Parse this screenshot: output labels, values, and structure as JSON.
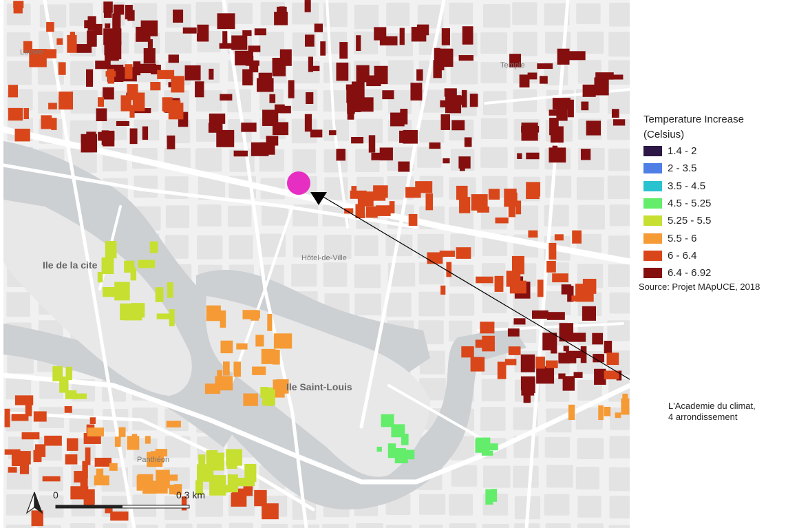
{
  "map": {
    "labels": {
      "louvre": "Louvre",
      "temple": "Temple",
      "ile_de_la_cite": "Ile de la cite",
      "hotel_de_ville": "Hôtel-de-Ville",
      "ile_saint_louis": "Ile Saint-Louis",
      "pantheon": "Panthéon"
    },
    "colors": {
      "background": "#f1f1f1",
      "blocks": "#e3e3e3",
      "roads": "#ffffff",
      "water": "#ccd0d3",
      "marker": "#e62fc2"
    }
  },
  "legend": {
    "title": "Temperature Increase (Celsius)",
    "classes": [
      {
        "label": "1.4 - 2",
        "color": "#2d1746"
      },
      {
        "label": "2 - 3.5",
        "color": "#4f7ee6"
      },
      {
        "label": "3.5 - 4.5",
        "color": "#29c3cf"
      },
      {
        "label": "4.5 - 5.25",
        "color": "#63ed6b"
      },
      {
        "label": "5.25 - 5.5",
        "color": "#c7df31"
      },
      {
        "label": "5.5 - 6",
        "color": "#f59a35"
      },
      {
        "label": "6 - 6.4",
        "color": "#d9461a"
      },
      {
        "label": "6.4 - 6.92",
        "color": "#850f0f"
      }
    ],
    "source": "Source: Projet MApUCE, 2018"
  },
  "callout": {
    "line1": "L'Academie du climat,",
    "line2": "4 arrondissement"
  },
  "scale_bar": {
    "start": "0",
    "end": "0.3 km"
  },
  "north_arrow": {
    "icon": "north-arrow-icon"
  }
}
